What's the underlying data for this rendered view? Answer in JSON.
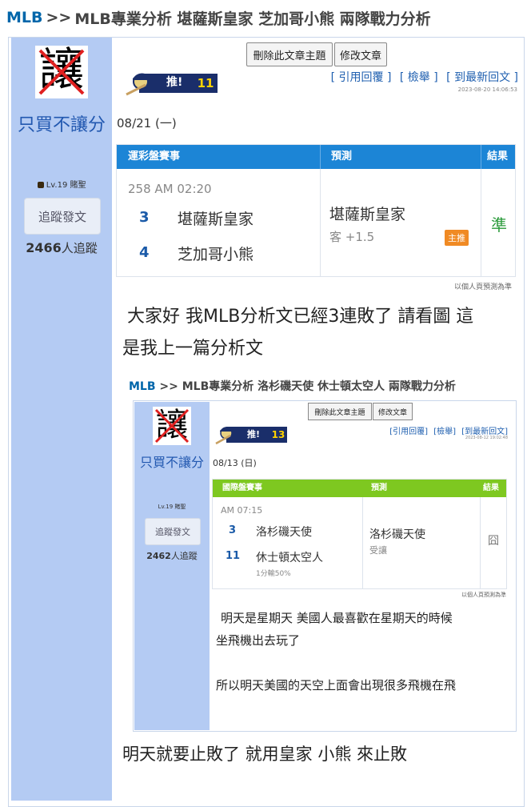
{
  "breadcrumb": {
    "category": "MLB",
    "separator": ">>",
    "title": "MLB專業分析 堪薩斯皇家 芝加哥小熊 兩隊戰力分析"
  },
  "author": {
    "avatar_char": "讓",
    "name": "只買不讓分",
    "level": "Lv.19 賭聖",
    "follow_label": "追蹤發文",
    "followers_count": "2466",
    "followers_suffix": "人追蹤"
  },
  "actions": {
    "delete_label": "刪除此文章主題",
    "edit_label": "修改文章"
  },
  "push": {
    "label": "推!",
    "count": "11"
  },
  "links": {
    "quote_reply": "[ 引用回覆 ]",
    "report": "[ 檢舉 ]",
    "latest_reply": "[ 到最新回文 ]"
  },
  "timestamp": "2023-08-20 14:06:53",
  "date": "08/21 (一)",
  "prediction": {
    "headers": {
      "event": "運彩盤賽事",
      "predict": "預測",
      "result": "結果"
    },
    "match_time": "258 AM 02:20",
    "teams": [
      {
        "num": "3",
        "name": "堪薩斯皇家"
      },
      {
        "num": "4",
        "name": "芝加哥小熊"
      }
    ],
    "pick": "堪薩斯皇家",
    "pick_sub": "客 +1.5",
    "badge": "主推",
    "result": "準",
    "note": "以個人頁預測為準"
  },
  "body_lines": [
    "大家好 我MLB分析文已經3連敗了 請看圖 這",
    "是我上一篇分析文"
  ],
  "quoted": {
    "breadcrumb": {
      "category": "MLB",
      "separator": ">>",
      "title": "MLB專業分析 洛杉磯天使 休士頓太空人 兩隊戰力分析"
    },
    "author": {
      "avatar_char": "讓",
      "name": "只買不讓分",
      "level": "Lv.19 賭聖",
      "follow_label": "追蹤發文",
      "followers_count": "2462",
      "followers_suffix": "人追蹤"
    },
    "actions": {
      "delete_label": "刪除此文章主題",
      "edit_label": "修改文章"
    },
    "push": {
      "label": "推!",
      "count": "13"
    },
    "links": {
      "quote_reply": "[引用回覆]",
      "report": "[檢舉]",
      "latest_reply": "[到最新回文]"
    },
    "timestamp": "2023-08-12 19:02:48",
    "date": "08/13 (日)",
    "prediction": {
      "headers": {
        "event": "國際盤賽事",
        "predict": "預測",
        "result": "結果"
      },
      "match_time": "AM 07:15",
      "teams": [
        {
          "num": "3",
          "name": "洛杉磯天使"
        },
        {
          "num": "11",
          "name": "休士頓太空人",
          "sub": "1分輸50%"
        }
      ],
      "pick": "洛杉磯天使",
      "pick_sub": "受讓",
      "result": "囧",
      "note": "以個人頁預測為準"
    },
    "body_lines": [
      "明天是星期天 美國人最喜歡在星期天的時候",
      "坐飛機出去玩了",
      "所以明天美國的天空上面會出現很多飛機在飛"
    ]
  },
  "closing_line": "明天就要止敗了 就用皇家 小熊 來止敗",
  "colors": {
    "link": "#2060b0",
    "header_blue": "#1c85d6",
    "header_green": "#7ec820",
    "sidebar": "#b4cbf3",
    "result_ok": "#2a9a3a",
    "badge": "#f08a24"
  }
}
